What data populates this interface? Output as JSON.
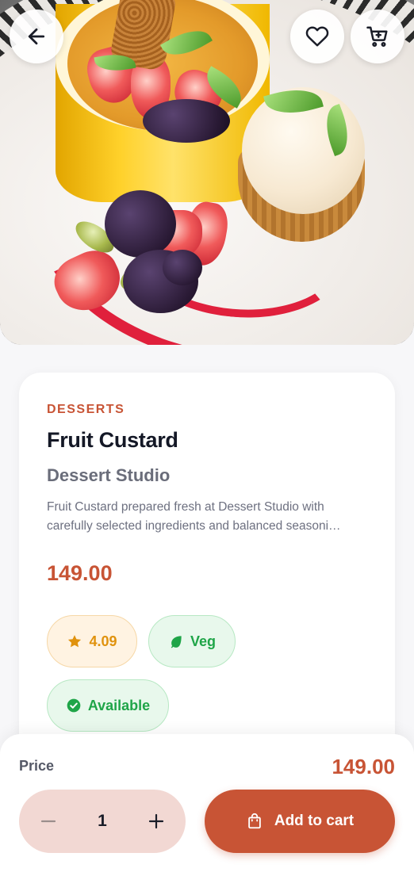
{
  "header": {
    "back_icon": "arrow-left-icon",
    "favorite_icon": "heart-outline-icon",
    "cart_icon": "shopping-cart-icon"
  },
  "product": {
    "category": "DESSERTS",
    "name": "Fruit Custard",
    "restaurant": "Dessert Studio",
    "description": "Fruit Custard prepared fresh at Dessert Studio with carefully selected ingredients and balanced seasoni…",
    "price": "149.00",
    "rating": "4.09",
    "diet_label": "Veg",
    "availability": "Available"
  },
  "bottom_bar": {
    "price_label": "Price",
    "total_price": "149.00",
    "quantity": "1",
    "add_to_cart_label": "Add to cart"
  },
  "colors": {
    "accent": "#c85435",
    "rating": "#e0920d",
    "veg_green": "#1fa548",
    "stepper_bg": "#f2d8d3"
  }
}
